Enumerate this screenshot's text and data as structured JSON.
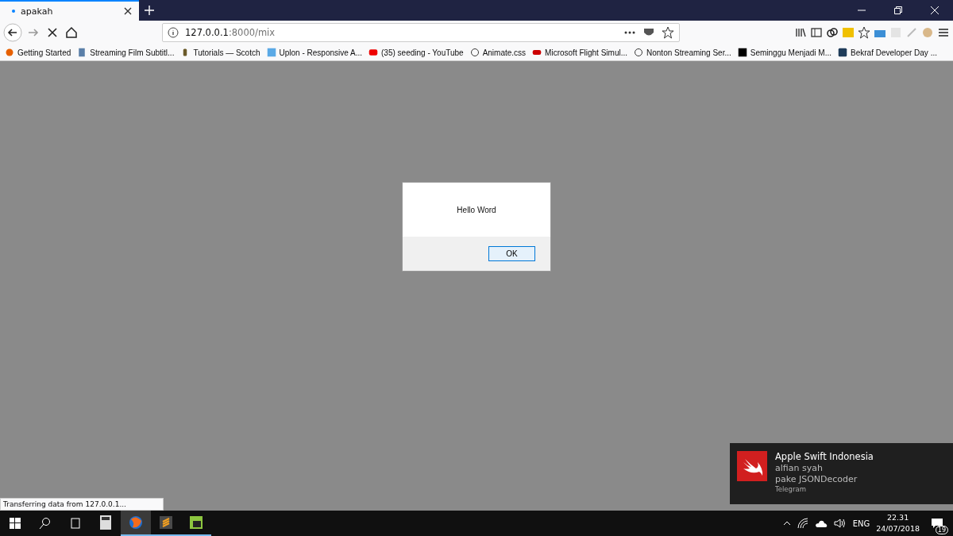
{
  "tab": {
    "title": "apakah",
    "selected": true
  },
  "address": {
    "host": "127.0.0.1",
    "path": ":8000/mix"
  },
  "bookmarks": [
    {
      "label": "Getting Started"
    },
    {
      "label": "Streaming Film Subtitl..."
    },
    {
      "label": "Tutorials — Scotch"
    },
    {
      "label": "Uplon - Responsive A..."
    },
    {
      "label": "(35) seeding - YouTube"
    },
    {
      "label": "Animate.css"
    },
    {
      "label": "Microsoft Flight Simul..."
    },
    {
      "label": "Nonton Streaming Ser..."
    },
    {
      "label": "Seminggu Menjadi M..."
    },
    {
      "label": "Bekraf Developer Day ..."
    }
  ],
  "dialog": {
    "message": "Hello Word",
    "button": "OK"
  },
  "status_text": "Transferring data from 127.0.0.1...",
  "notification": {
    "title": "Apple Swift Indonesia",
    "sender": "alfian syah",
    "message": "pake JSONDecoder",
    "app": "Telegram"
  },
  "taskbar": {
    "apps": [
      {
        "selected": false,
        "running": false
      },
      {
        "selected": true,
        "running": true
      },
      {
        "selected": false,
        "running": true
      },
      {
        "selected": false,
        "running": true
      }
    ],
    "language": "ENG",
    "time": "22.31",
    "date": "24/07/2018",
    "notification_count": "19"
  }
}
